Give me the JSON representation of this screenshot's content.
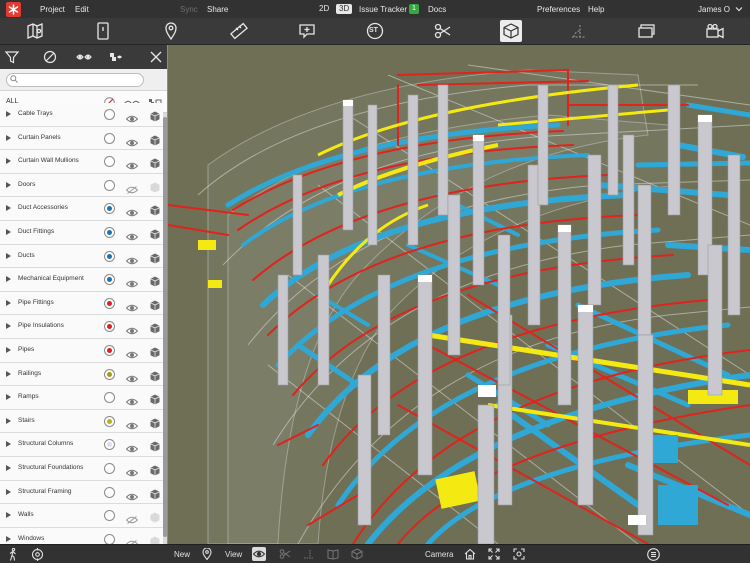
{
  "menu": {
    "project": "Project",
    "edit": "Edit",
    "sync": "Sync",
    "share": "Share",
    "view_2d": "2D",
    "view_3d": "3D",
    "issue_tracker": "Issue Tracker",
    "issue_count": "1",
    "docs": "Docs",
    "preferences": "Preferences",
    "help": "Help",
    "user": "James O"
  },
  "toolbar": {
    "icons": [
      "map-pin-sheet-icon",
      "sheet-icon",
      "location-pin-icon",
      "ruler-icon",
      "comment-add-icon",
      "st-icon",
      "scissors-icon",
      "cube-icon",
      "dimension-icon",
      "screens-icon",
      "camera-icon"
    ],
    "st_label": "ST",
    "active": "cube-icon"
  },
  "sidebar": {
    "tools": [
      "filter-icon",
      "hide-all-icon",
      "show-hidden-icon",
      "isolate-icon",
      "close-icon"
    ],
    "search": {
      "placeholder": "",
      "value": ""
    },
    "all_label": "ALL",
    "categories": [
      {
        "name": "Cable Trays",
        "color": "",
        "visible": true
      },
      {
        "name": "Curtain Panels",
        "color": "",
        "visible": true
      },
      {
        "name": "Curtain Wall Mullions",
        "color": "",
        "visible": true
      },
      {
        "name": "Doors",
        "color": "",
        "visible": false
      },
      {
        "name": "Duct Accessories",
        "color": "#1e74b0",
        "visible": true
      },
      {
        "name": "Duct Fittings",
        "color": "#1e74b0",
        "visible": true
      },
      {
        "name": "Ducts",
        "color": "#1e74b0",
        "visible": true
      },
      {
        "name": "Mechanical Equipment",
        "color": "#1e74b0",
        "visible": true
      },
      {
        "name": "Pipe Fittings",
        "color": "#e02020",
        "visible": true
      },
      {
        "name": "Pipe Insulations",
        "color": "#e02020",
        "visible": true
      },
      {
        "name": "Pipes",
        "color": "#e02020",
        "visible": true
      },
      {
        "name": "Railings",
        "color": "#a89a14",
        "visible": true
      },
      {
        "name": "Ramps",
        "color": "",
        "visible": true
      },
      {
        "name": "Stairs",
        "color": "#b7b21a",
        "visible": true
      },
      {
        "name": "Structural Columns",
        "color": "#dcdcf5",
        "visible": true
      },
      {
        "name": "Structural Foundations",
        "color": "",
        "visible": true
      },
      {
        "name": "Structural Framing",
        "color": "",
        "visible": true
      },
      {
        "name": "Walls",
        "color": "",
        "visible": false
      },
      {
        "name": "Windows",
        "color": "",
        "visible": false
      }
    ]
  },
  "bottombar": {
    "new_label": "New",
    "view_label": "View",
    "camera_label": "Camera",
    "icons": [
      "walk-icon",
      "orbit-icon",
      "pin-icon",
      "eye-icon",
      "scissors-icon",
      "dimension-icon",
      "book-icon",
      "cube-icon",
      "home-icon",
      "fit-icon",
      "zoom-extents-icon",
      "list-icon"
    ]
  },
  "colors": {
    "background": "#6f6f56",
    "duct": "#2fa8d6",
    "pipe": "#e0231c",
    "tray": "#f4ea12",
    "column": "#c8c8ce",
    "accent": "#e23a2f"
  }
}
